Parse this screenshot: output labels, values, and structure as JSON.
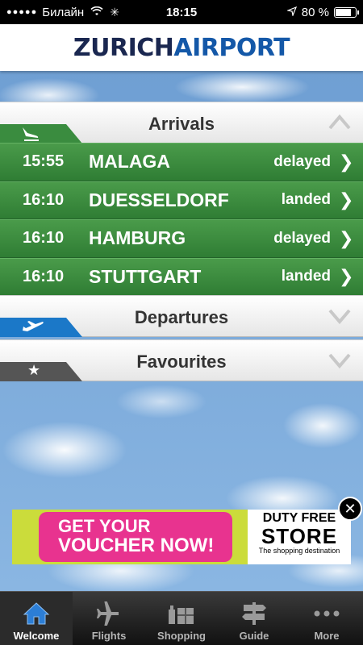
{
  "status_bar": {
    "signal": "●●●●●",
    "carrier": "Билайн",
    "time": "18:15",
    "battery": "80 %",
    "battery_level": 0.8
  },
  "header": {
    "logo_main": "ZURICH",
    "logo_accent": "AIRPORT"
  },
  "arrivals": {
    "title": "Arrivals",
    "flights": [
      {
        "time": "15:55",
        "city": "MALAGA",
        "status": "delayed"
      },
      {
        "time": "16:10",
        "city": "DUESSELDORF",
        "status": "landed"
      },
      {
        "time": "16:10",
        "city": "HAMBURG",
        "status": "delayed"
      },
      {
        "time": "16:10",
        "city": "STUTTGART",
        "status": "landed"
      }
    ]
  },
  "departures": {
    "title": "Departures"
  },
  "favourites": {
    "title": "Favourites"
  },
  "ad": {
    "line1": "GET YOUR",
    "line2": "VOUCHER NOW!",
    "brand1": "DUTY FREE",
    "brand2": "STORE",
    "tagline": "The shopping destination",
    "close": "✕"
  },
  "tabbar": {
    "items": [
      {
        "label": "Welcome",
        "icon": "home-icon"
      },
      {
        "label": "Flights",
        "icon": "airplane-icon"
      },
      {
        "label": "Shopping",
        "icon": "shopping-icon"
      },
      {
        "label": "Guide",
        "icon": "signpost-icon"
      },
      {
        "label": "More",
        "icon": "more-icon"
      }
    ]
  },
  "colors": {
    "arrivals_green": "#3a8c3f",
    "departures_blue": "#1b78c8",
    "favourites_gray": "#555555",
    "ad_pink": "#e8338f",
    "ad_lime": "#cbdc3b",
    "tab_active_blue": "#2c7ed6"
  }
}
